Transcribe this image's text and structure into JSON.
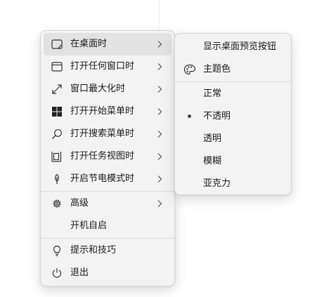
{
  "main_menu": {
    "items": [
      {
        "label": "在桌面时",
        "icon": "desktop-icon",
        "submenu": true,
        "active": true
      },
      {
        "label": "打开任何窗口时",
        "icon": "window-icon",
        "submenu": true
      },
      {
        "label": "窗口最大化时",
        "icon": "maximize-icon",
        "submenu": true
      },
      {
        "label": "打开开始菜单时",
        "icon": "windows-logo-icon",
        "submenu": true
      },
      {
        "label": "打开搜索菜单时",
        "icon": "search-icon",
        "submenu": true
      },
      {
        "label": "打开任务视图时",
        "icon": "task-view-icon",
        "submenu": true
      },
      {
        "label": "开启节电模式时",
        "icon": "leaf-icon",
        "submenu": true
      },
      {
        "label": "高级",
        "icon": "gear-icon",
        "submenu": true
      },
      {
        "label": "开机自启"
      },
      {
        "label": "提示和技巧",
        "icon": "lightbulb-icon"
      },
      {
        "label": "退出",
        "icon": "power-icon"
      }
    ]
  },
  "sub_menu": {
    "items": [
      {
        "label": "显示桌面预览按钮"
      },
      {
        "label": "主题色",
        "icon": "palette-icon"
      },
      {
        "label": "正常"
      },
      {
        "label": "不透明",
        "selected": true
      },
      {
        "label": "透明"
      },
      {
        "label": "模糊"
      },
      {
        "label": "亚克力"
      }
    ]
  }
}
